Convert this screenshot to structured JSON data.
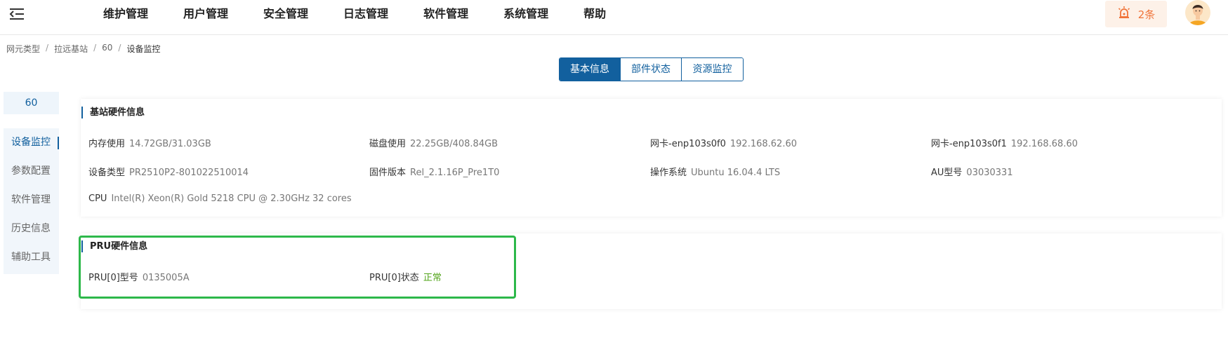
{
  "nav": [
    "维护管理",
    "用户管理",
    "安全管理",
    "日志管理",
    "软件管理",
    "系统管理",
    "帮助"
  ],
  "alert": {
    "count": "2条"
  },
  "breadcrumb": [
    "网元类型",
    "拉远基站",
    "60",
    "设备监控"
  ],
  "tabs": [
    "基本信息",
    "部件状态",
    "资源监控"
  ],
  "node": "60",
  "sidemenu": [
    "设备监控",
    "参数配置",
    "软件管理",
    "历史信息",
    "辅助工具"
  ],
  "base_hw": {
    "title": "基站硬件信息",
    "fields": [
      {
        "k": "内存使用",
        "v": "14.72GB/31.03GB"
      },
      {
        "k": "磁盘使用",
        "v": "22.25GB/408.84GB"
      },
      {
        "k": "网卡-enp103s0f0",
        "v": "192.168.62.60"
      },
      {
        "k": "网卡-enp103s0f1",
        "v": "192.168.68.60"
      },
      {
        "k": "设备类型",
        "v": "PR2510P2-801022510014"
      },
      {
        "k": "固件版本",
        "v": "Rel_2.1.16P_Pre1T0"
      },
      {
        "k": "操作系统",
        "v": "Ubuntu 16.04.4 LTS"
      },
      {
        "k": "AU型号",
        "v": "03030331"
      },
      {
        "k": "CPU",
        "v": "Intel(R) Xeon(R) Gold 5218 CPU @ 2.30GHz 32 cores"
      }
    ]
  },
  "pru_hw": {
    "title": "PRU硬件信息",
    "fields": [
      {
        "k": "PRU[0]型号",
        "v": "0135005A"
      },
      {
        "k": "PRU[0]状态",
        "v": "正常"
      }
    ]
  },
  "colors": {
    "accent": "#12609e",
    "ok": "#52a41a",
    "alert": "#f0743a",
    "highlight": "#2db84a"
  },
  "icons": {
    "menu": "menu-fold-icon",
    "alarm": "siren-icon",
    "avatar": "user-avatar-icon"
  }
}
